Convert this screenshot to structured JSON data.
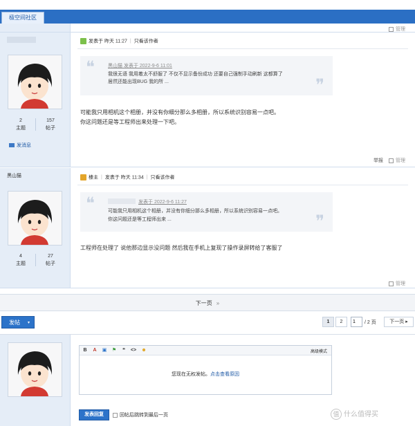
{
  "header": {
    "forum_tab": "极空间社区"
  },
  "posts": [
    {
      "author": "",
      "stats": {
        "topics_value": "2",
        "topics_label": "主题",
        "posts_value": "157",
        "posts_label": "帖子"
      },
      "send_message": "发消息",
      "meta": {
        "posted": "发表于 昨天 11:27",
        "only_author": "只看该作者"
      },
      "quote": {
        "header": "黑山猫 发表于 2022-9-6 11:01",
        "lines": [
          "我很无语 我用着太不舒服了 不仅不显示备份成功 还要自己强制手动刷新 这都算了",
          "居然还能出现BUG 我的所 ..."
        ]
      },
      "body": [
        "可能我只用相机这个相册，并没有你细分那么多相册，所以系统识别容易一点吧。",
        "你这问题还是等工程师出来处理一下吧。"
      ],
      "actions": {
        "report": "举报",
        "manage": "管理"
      }
    },
    {
      "author": "黑山猫",
      "stats": {
        "topics_value": "4",
        "topics_label": "主题",
        "posts_value": "27",
        "posts_label": "帖子"
      },
      "meta": {
        "role": "楼主",
        "posted": "发表于 昨天 11:34",
        "only_author": "只看该作者"
      },
      "quote": {
        "header": "发表于 2022-9-6 11:27",
        "lines": [
          "可能我只用相机这个相册，并没有你细分那么多相册，所以系统识别容易一点吧。",
          "你这问题还是等工程师出来 ..."
        ]
      },
      "body": [
        "工程师在处理了 说他那边显示没问题 然后我在手机上复现了操作录屏转给了客服了"
      ],
      "actions": {
        "manage": "管理"
      }
    }
  ],
  "top_manage": "管理",
  "pager": {
    "next_page": "下一页",
    "next_arrow": "»",
    "pages": [
      "1",
      "2"
    ],
    "current_input": "1",
    "total": "/ 2 页",
    "next_button": "下一页 ▸"
  },
  "post_button": {
    "label": "发帖",
    "caret": "▾"
  },
  "reply": {
    "toolbar": [
      "B",
      "A",
      "▣",
      "⚑",
      "❝",
      "<>",
      "☻"
    ],
    "advanced_mode": "高级模式",
    "notice_text": "您现在无权发帖。",
    "notice_link": "点击查看原因",
    "submit_label": "发表回复",
    "jump_last_label": "回帖后跳转到最后一页"
  },
  "watermark": {
    "icon": "值",
    "text": "什么值得买"
  },
  "colors": {
    "accent": "#2c73c9",
    "sidebar_bg": "#e5edf7",
    "link": "#1f5aa6"
  }
}
